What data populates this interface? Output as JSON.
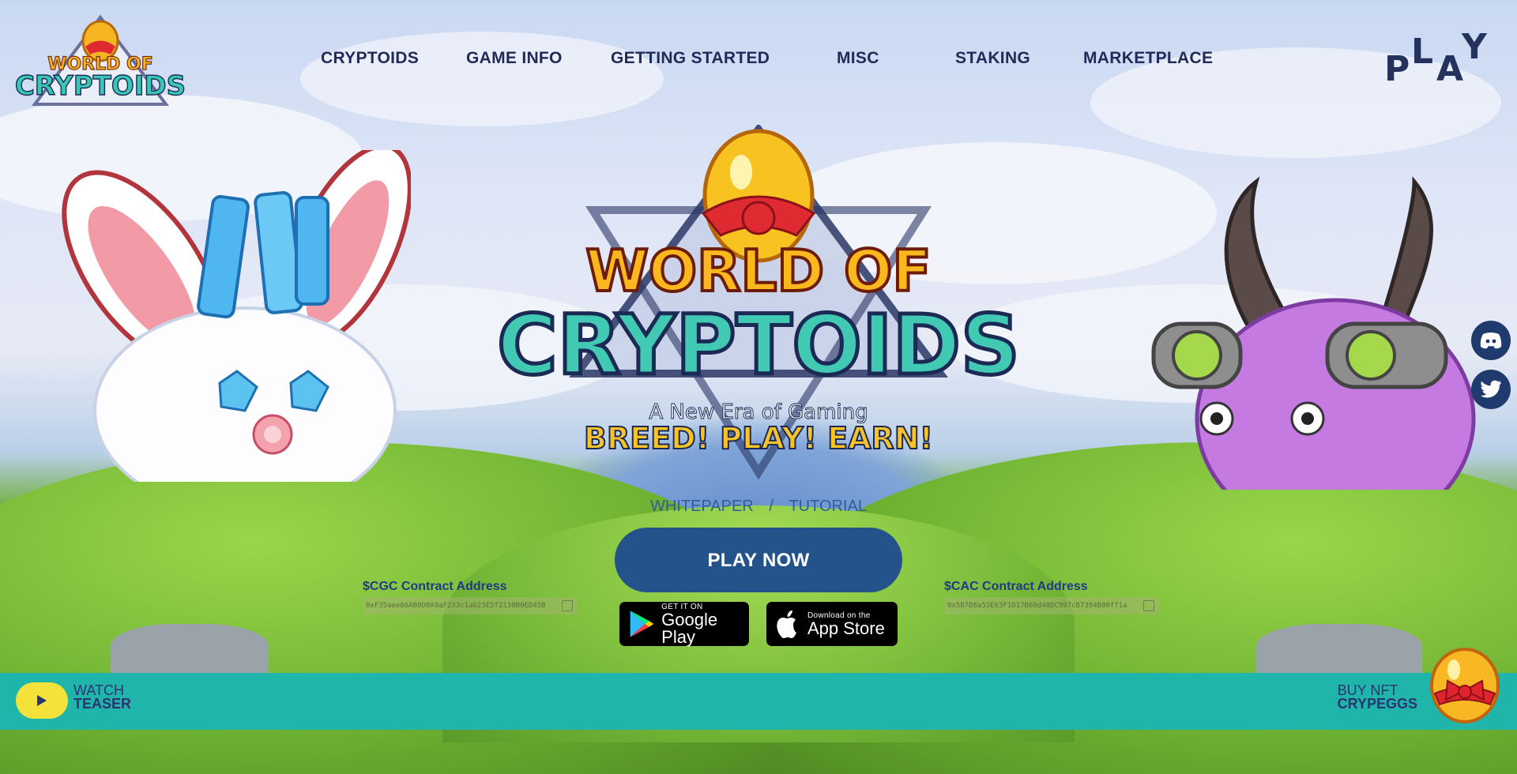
{
  "header": {
    "logo_alt": "World of Cryptoids",
    "nav": [
      {
        "label": "CRYPTOIDS"
      },
      {
        "label": "GAME INFO"
      },
      {
        "label": "GETTING STARTED"
      },
      {
        "label": "MISC"
      },
      {
        "label": "STAKING"
      },
      {
        "label": "MARKETPLACE"
      }
    ],
    "play_label": "PLAY"
  },
  "hero": {
    "logo_line1": "WORLD OF",
    "logo_line2": "CRYPTOIDS",
    "tagline": "A New Era of Gaming",
    "slogan": "BREED! PLAY! EARN!",
    "links": {
      "whitepaper": "WHITEPAPER",
      "separator": "/",
      "tutorial": "TUTORIAL"
    },
    "play_now": "PLAY NOW",
    "google_play": {
      "small": "GET IT ON",
      "big": "Google Play"
    },
    "app_store": {
      "small": "Download on the",
      "big": "App Store"
    }
  },
  "contracts": {
    "cgc": {
      "title": "$CGC Contract Address",
      "address": "0xF35aee66AB0D0A9aF233c1ab23E5f2138B0ED45B"
    },
    "cac": {
      "title": "$CAC Contract Address",
      "address": "0x5B7D8a53E63F1817B69d40DC997cB7394B80ff1a"
    }
  },
  "social": {
    "discord": "discord-icon",
    "twitter": "twitter-icon"
  },
  "footer": {
    "watch_line1": "WATCH",
    "watch_line2": "TEASER",
    "buy_line1": "BUY NFT",
    "buy_line2": "CRYPEGGS"
  },
  "colors": {
    "nav_text": "#222b57",
    "play_button": "#24528a",
    "footer_bg": "#1fb5ab",
    "watch_button": "#f4e23a"
  }
}
